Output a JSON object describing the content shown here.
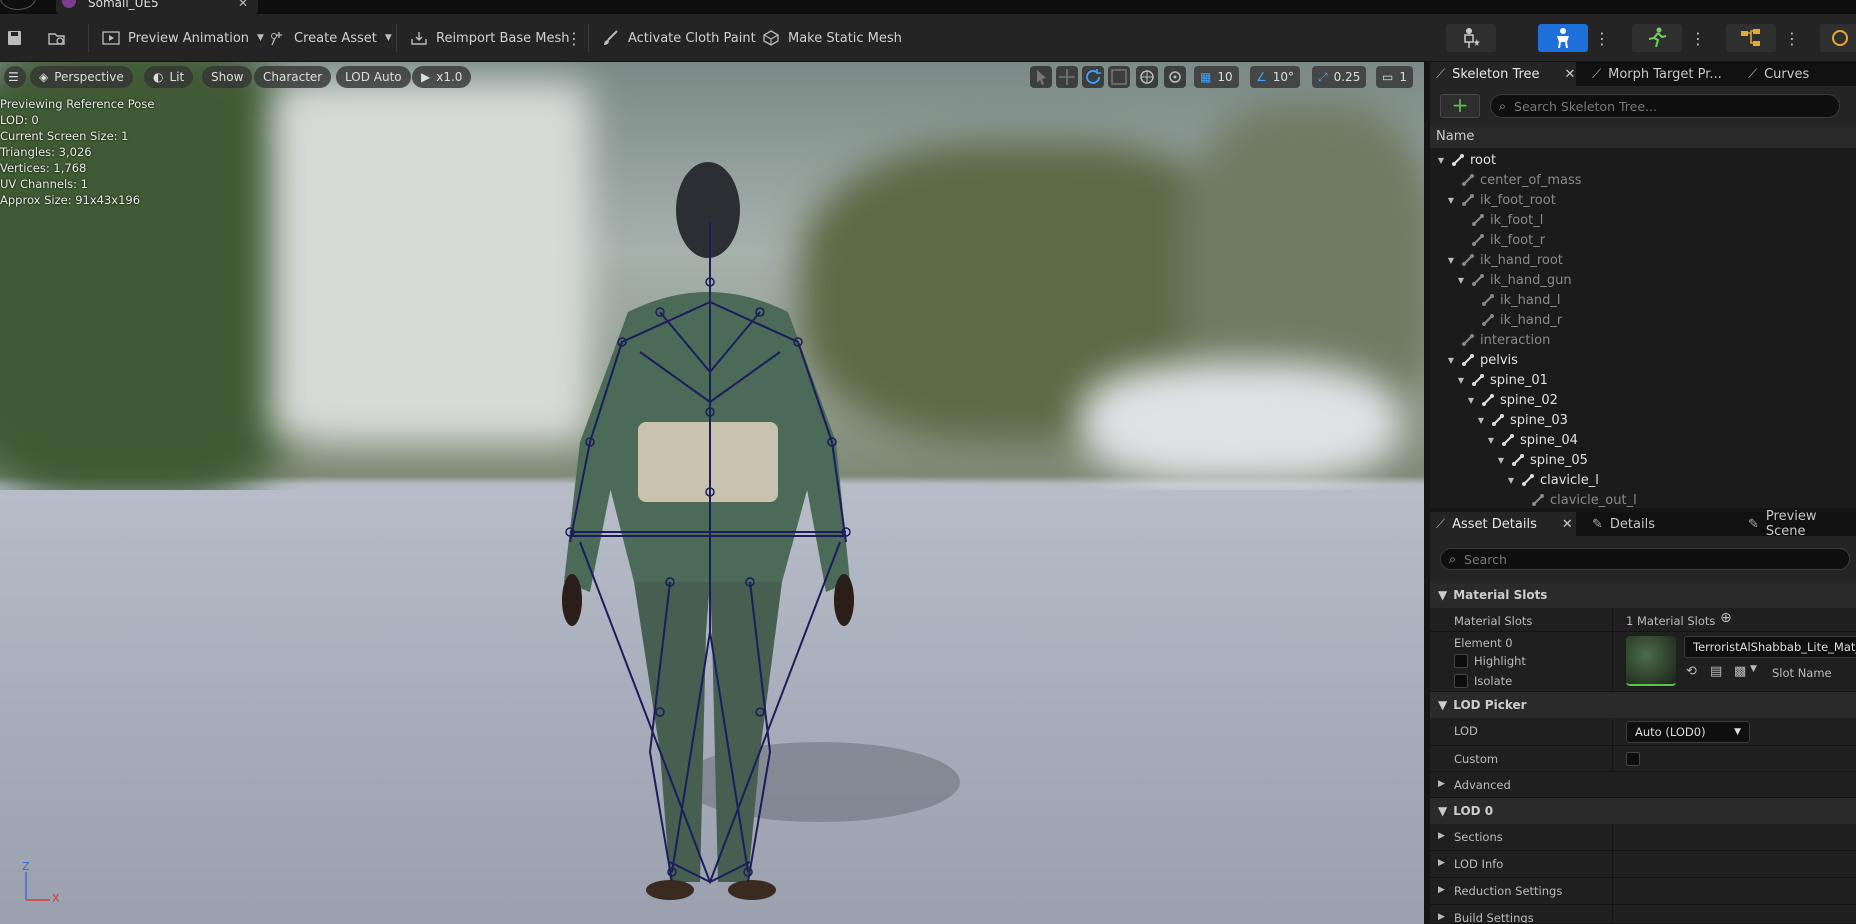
{
  "window": {
    "doc_tab": "Somali_UE5"
  },
  "toolbar": {
    "preview_animation": "Preview Animation",
    "create_asset": "Create Asset",
    "reimport_base_mesh": "Reimport Base Mesh",
    "activate_cloth_paint": "Activate Cloth Paint",
    "make_static_mesh": "Make Static Mesh"
  },
  "viewport": {
    "perspective": "Perspective",
    "lit": "Lit",
    "show": "Show",
    "character": "Character",
    "lod_auto": "LOD Auto",
    "play_rate": "x1.0",
    "grid_snap": "10",
    "rotation_snap": "10°",
    "scale_snap": "0.25",
    "camera_speed": "1",
    "stats": [
      "Previewing Reference Pose",
      "LOD: 0",
      "Current Screen Size: 1",
      "Triangles: 3,026",
      "Vertices: 1,768",
      "UV Channels: 1",
      "Approx Size: 91x43x196"
    ],
    "axis_z": "Z",
    "axis_x": "X"
  },
  "skeleton_panel": {
    "tabs": [
      "Skeleton Tree",
      "Morph Target Pr...",
      "Curves"
    ],
    "search_placeholder": "Search Skeleton Tree...",
    "column_name": "Name",
    "bones": [
      {
        "name": "root",
        "depth": 0,
        "expanded": true,
        "active": true
      },
      {
        "name": "center_of_mass",
        "depth": 1,
        "expanded": null,
        "active": false
      },
      {
        "name": "ik_foot_root",
        "depth": 1,
        "expanded": true,
        "active": false
      },
      {
        "name": "ik_foot_l",
        "depth": 2,
        "expanded": null,
        "active": false
      },
      {
        "name": "ik_foot_r",
        "depth": 2,
        "expanded": null,
        "active": false
      },
      {
        "name": "ik_hand_root",
        "depth": 1,
        "expanded": true,
        "active": false
      },
      {
        "name": "ik_hand_gun",
        "depth": 2,
        "expanded": true,
        "active": false
      },
      {
        "name": "ik_hand_l",
        "depth": 3,
        "expanded": null,
        "active": false
      },
      {
        "name": "ik_hand_r",
        "depth": 3,
        "expanded": null,
        "active": false
      },
      {
        "name": "interaction",
        "depth": 1,
        "expanded": null,
        "active": false
      },
      {
        "name": "pelvis",
        "depth": 1,
        "expanded": true,
        "active": true
      },
      {
        "name": "spine_01",
        "depth": 2,
        "expanded": true,
        "active": true
      },
      {
        "name": "spine_02",
        "depth": 3,
        "expanded": true,
        "active": true
      },
      {
        "name": "spine_03",
        "depth": 4,
        "expanded": true,
        "active": true
      },
      {
        "name": "spine_04",
        "depth": 5,
        "expanded": true,
        "active": true
      },
      {
        "name": "spine_05",
        "depth": 6,
        "expanded": true,
        "active": true
      },
      {
        "name": "clavicle_l",
        "depth": 7,
        "expanded": true,
        "active": true
      },
      {
        "name": "clavicle_out_l",
        "depth": 8,
        "expanded": null,
        "active": false
      }
    ]
  },
  "details_panel": {
    "tabs": [
      "Asset Details",
      "Details",
      "Preview Scene"
    ],
    "search_placeholder": "Search",
    "material_slots_section": "Material Slots",
    "material_slots_label": "Material Slots",
    "material_slots_value": "1 Material Slots",
    "element_label": "Element 0",
    "highlight_label": "Highlight",
    "isolate_label": "Isolate",
    "material_name": "TerroristAlShabbab_Lite_Mat_Ins",
    "slot_name_label": "Slot Name",
    "lod_picker_section": "LOD Picker",
    "lod_label": "LOD",
    "lod_value": "Auto (LOD0)",
    "custom_label": "Custom",
    "advanced_section": "Advanced",
    "lod0_section": "LOD 0",
    "sections_label": "Sections",
    "lod_info_label": "LOD Info",
    "reduction_settings_label": "Reduction Settings",
    "build_settings_label": "Build Settings"
  },
  "colors": {
    "accent_blue": "#1e6fd9",
    "add_green": "#5cc24b",
    "bone_wire": "#1b1e5a"
  }
}
